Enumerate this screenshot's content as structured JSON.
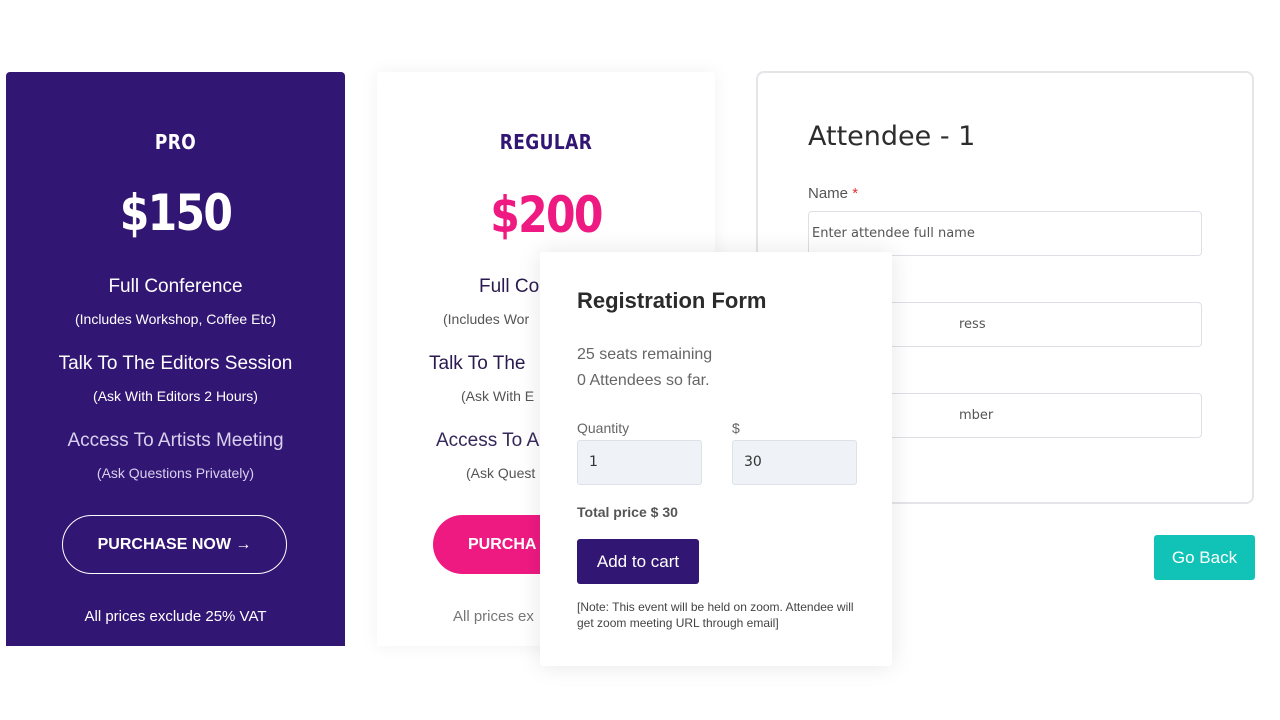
{
  "pro": {
    "name": "PRO",
    "price": "$150",
    "features": [
      {
        "title": "Full Conference",
        "sub": "(Includes Workshop, Coffee Etc)"
      },
      {
        "title": "Talk To The Editors Session",
        "sub": "(Ask With Editors 2 Hours)"
      },
      {
        "title": "Access To Artists Meeting",
        "sub": "(Ask Questions Privately)"
      }
    ],
    "button": "PURCHASE NOW →",
    "vat": "All prices exclude 25% VAT"
  },
  "regular": {
    "name": "REGULAR",
    "price": "$200",
    "features": [
      {
        "title": "Full Co",
        "sub": "(Includes Wor"
      },
      {
        "title": "Talk To The",
        "sub": "(Ask With E"
      },
      {
        "title": "Access To A",
        "sub": "(Ask Quest"
      }
    ],
    "button": "PURCHA",
    "vat": "All prices ex"
  },
  "attendee": {
    "title": "Attendee - 1",
    "name_label": "Name",
    "required_mark": "*",
    "name_placeholder": "Enter attendee full name",
    "email_placeholder_partial": "ress",
    "phone_placeholder_partial": "mber"
  },
  "go_back": "Go Back",
  "popup": {
    "title": "Registration Form",
    "seats": "25 seats remaining",
    "attendees": "0 Attendees so far.",
    "quantity_label": "Quantity",
    "currency_label": "$",
    "quantity_value": "1",
    "price_value": "30",
    "total": "Total price $ 30",
    "add_to_cart": "Add to cart",
    "note": "[Note: This event will be held on zoom. Attendee will get zoom meeting URL through email]"
  },
  "colors": {
    "pro_bg": "#321673",
    "regular_price": "#ee1a82",
    "go_back": "#10c3b6",
    "add_to_cart": "#321673"
  }
}
